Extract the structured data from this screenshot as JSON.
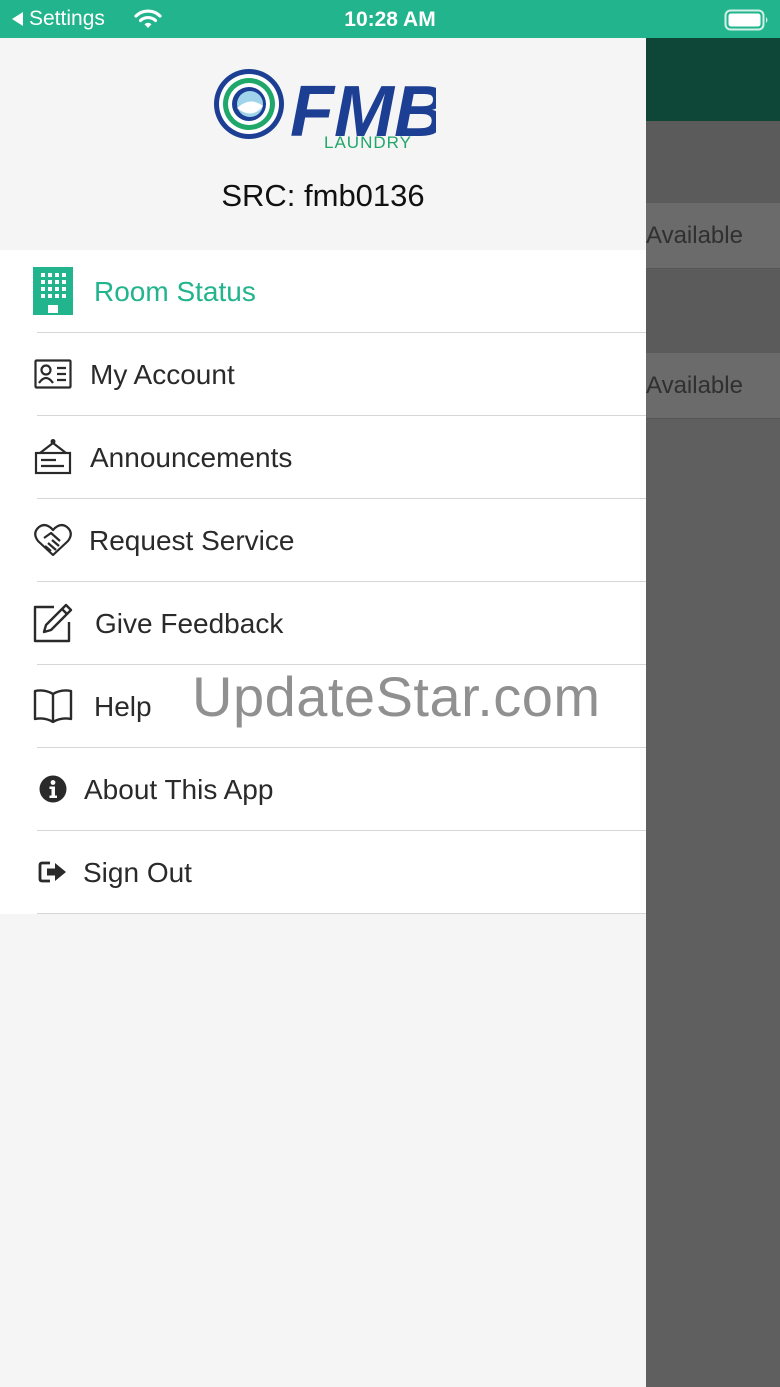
{
  "status_bar": {
    "back_label": "Settings",
    "time": "10:28 AM"
  },
  "drawer": {
    "logo_text": "FMB",
    "logo_subtext": "LAUNDRY",
    "src_label": "SRC: fmb0136",
    "menu": [
      {
        "label": "Room Status",
        "icon": "building-icon",
        "active": true
      },
      {
        "label": "My Account",
        "icon": "id-card-icon"
      },
      {
        "label": "Announcements",
        "icon": "hanging-sign-icon"
      },
      {
        "label": "Request Service",
        "icon": "handshake-heart-icon"
      },
      {
        "label": "Give Feedback",
        "icon": "edit-icon"
      },
      {
        "label": "Help",
        "icon": "book-icon"
      },
      {
        "label": "About This App",
        "icon": "info-icon"
      },
      {
        "label": "Sign Out",
        "icon": "sign-out-icon"
      }
    ]
  },
  "background_app": {
    "rows": [
      "Available",
      "Available"
    ]
  },
  "watermark": "UpdateStar.com",
  "colors": {
    "accent": "#22b48c",
    "nav_dark": "#0e4637",
    "logo_blue": "#1c3f94",
    "logo_green": "#1fa86a"
  }
}
